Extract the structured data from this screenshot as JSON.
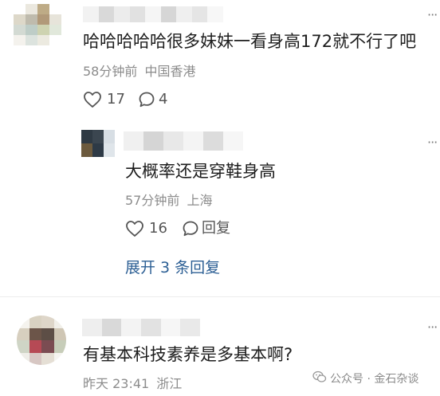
{
  "comments": [
    {
      "text": "哈哈哈哈哈很多妹妹一看身高172就不行了吧",
      "time": "58分钟前",
      "location": "中国香港",
      "likes": "17",
      "replies": "4"
    },
    {
      "text": "大概率还是穿鞋身高",
      "time": "57分钟前",
      "location": "上海",
      "likes": "16",
      "reply_label": "回复"
    },
    {
      "text": "有基本科技素养是多基本啊?",
      "time": "昨天 23:41",
      "location": "浙江"
    }
  ],
  "expand_replies": "展开 3 条回复",
  "more_glyph": "···",
  "watermark": {
    "text": "公众号 · 金石杂谈",
    "icon": "wechat-icon"
  },
  "colors": {
    "link": "#2c5f94",
    "meta": "#8c8c8c",
    "text": "#1d1d1d"
  }
}
